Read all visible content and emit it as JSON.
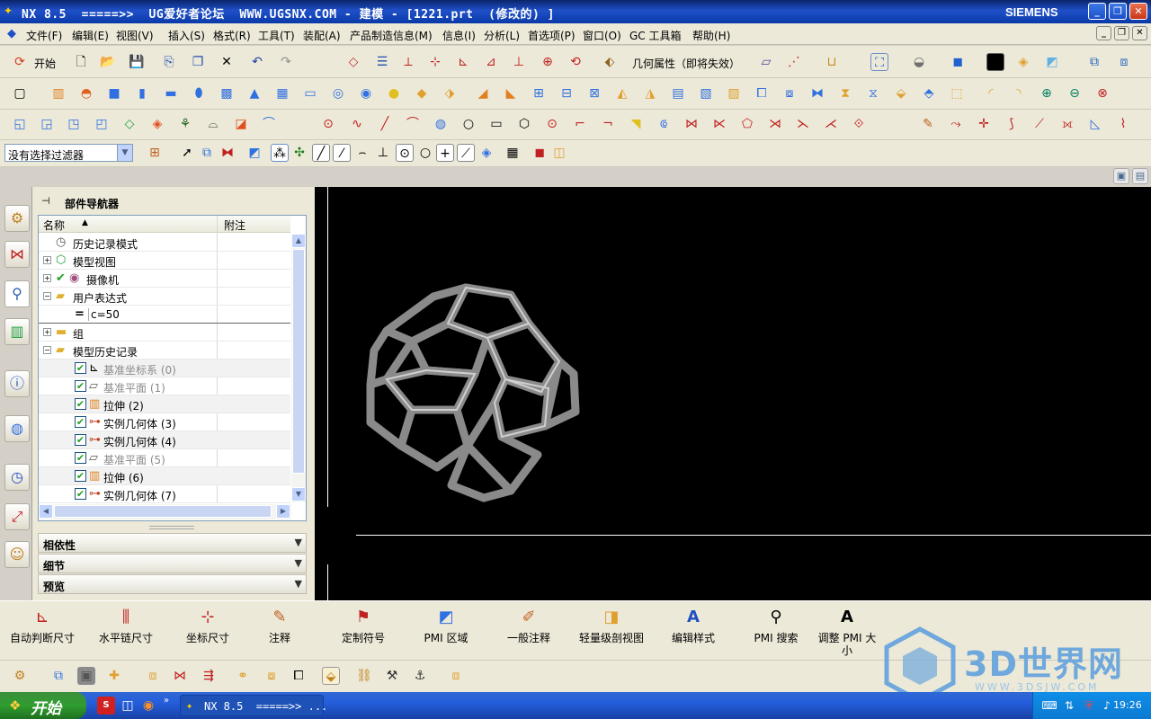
{
  "window": {
    "title": "NX 8.5  =====>>  UG爱好者论坛  WWW.UGSNX.COM - 建模 - [1221.prt  (修改的) ]",
    "brand": "SIEMENS",
    "minimize": "_",
    "restore": "❐",
    "close": "✕"
  },
  "menubar": {
    "items": [
      "文件(F)",
      "编辑(E)",
      "视图(V)",
      "插入(S)",
      "格式(R)",
      "工具(T)",
      "装配(A)",
      "产品制造信息(M)",
      "信息(I)",
      "分析(L)",
      "首选项(P)",
      "窗口(O)",
      "GC 工具箱",
      "帮助(H)"
    ]
  },
  "toolbar1": {
    "start_label": "开始",
    "geometry_property": "几何属性（即将失效）"
  },
  "filter": {
    "value": "没有选择过滤器"
  },
  "navigator": {
    "title": "部件导航器",
    "col_name": "名称",
    "col_note": "附注",
    "rows": [
      {
        "label": "历史记录模式",
        "icon": "clock-icon"
      },
      {
        "label": "模型视图",
        "icon": "model-views-icon"
      },
      {
        "label": "摄像机",
        "icon": "camera-icon"
      },
      {
        "label": "用户表达式",
        "icon": "folder-open-icon"
      },
      {
        "label": "c=50",
        "icon": "expression-icon"
      },
      {
        "label": "组",
        "icon": "folder-icon"
      },
      {
        "label": "模型历史记录",
        "icon": "folder-open-icon"
      },
      {
        "label": "基准坐标系 (0)",
        "icon": "datum-csys-icon"
      },
      {
        "label": "基准平面 (1)",
        "icon": "datum-plane-icon"
      },
      {
        "label": "拉伸 (2)",
        "icon": "extrude-icon"
      },
      {
        "label": "实例几何体 (3)",
        "icon": "instance-geometry-icon"
      },
      {
        "label": "实例几何体 (4)",
        "icon": "instance-geometry-icon"
      },
      {
        "label": "基准平面 (5)",
        "icon": "datum-plane-icon"
      },
      {
        "label": "拉伸 (6)",
        "icon": "extrude-icon"
      },
      {
        "label": "实例几何体 (7)",
        "icon": "instance-geometry-icon"
      }
    ],
    "sections": [
      "相依性",
      "细节",
      "预览"
    ]
  },
  "pmi": {
    "items": [
      "自动判断尺寸",
      "水平链尺寸",
      "坐标尺寸",
      "注释",
      "定制符号",
      "PMI 区域",
      "一般注释",
      "轻量级剖视图",
      "编辑样式",
      "PMI 搜索",
      "调整 PMI 大小"
    ]
  },
  "taskbar": {
    "start": "开始",
    "task": "NX 8.5  =====>> ...",
    "clock": "19:26"
  },
  "watermark": {
    "text": "3D世界网",
    "url": "WWW.3DSJW.COM"
  },
  "colors": {
    "titlebar": "#0a246a",
    "viewport": "#000000",
    "panel": "#ece9d8",
    "checkmark": "#21a121"
  }
}
